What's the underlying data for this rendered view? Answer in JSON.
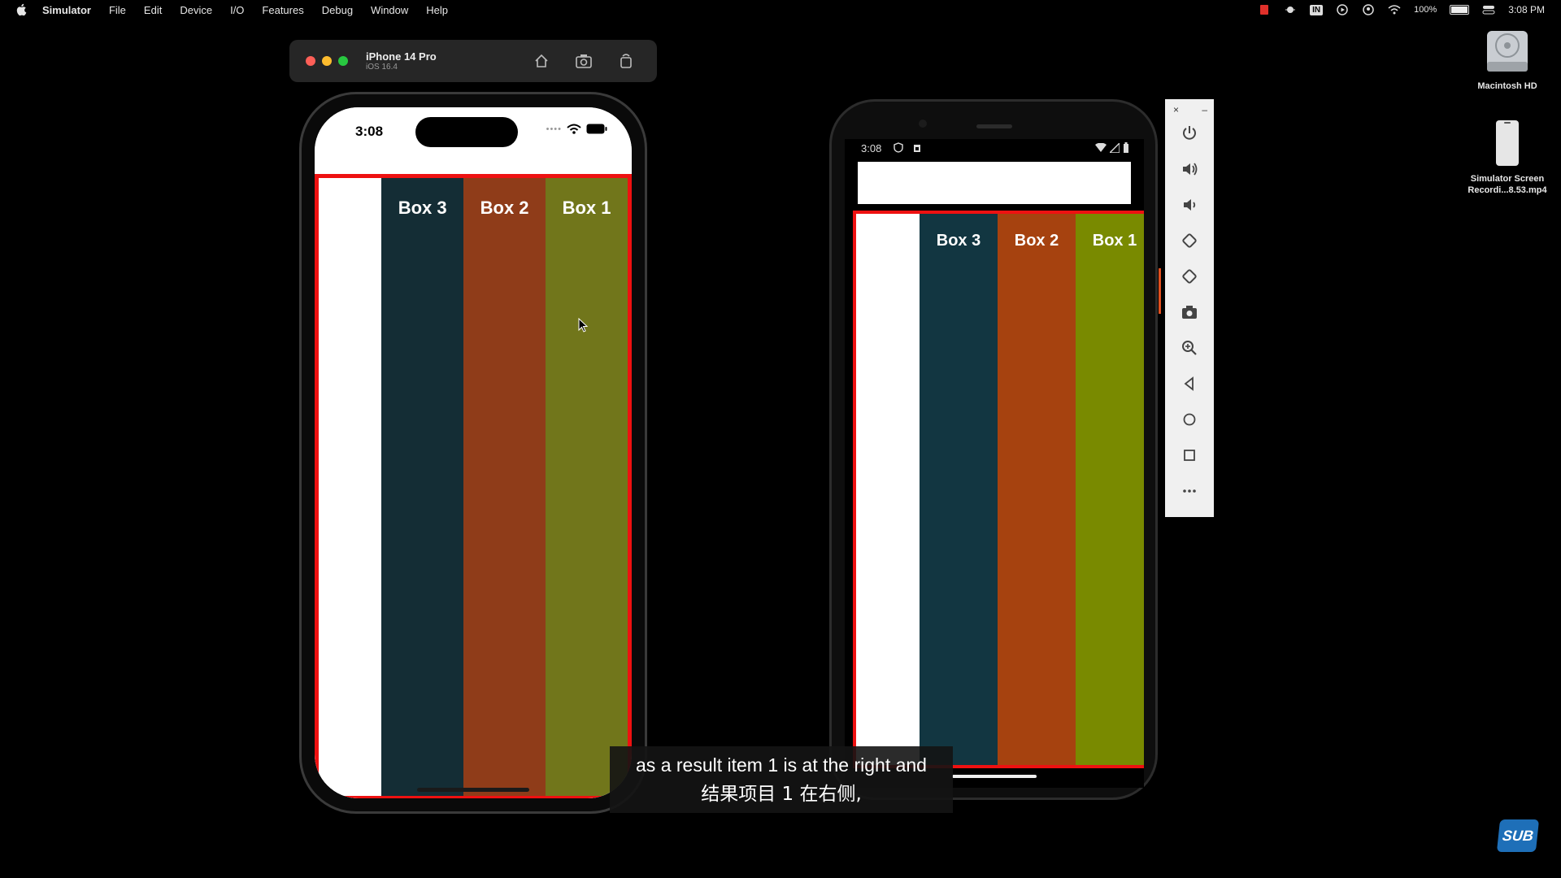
{
  "menubar": {
    "app_name": "Simulator",
    "items": [
      "File",
      "Edit",
      "Device",
      "I/O",
      "Features",
      "Debug",
      "Window",
      "Help"
    ],
    "battery": "100%",
    "clock": "3:08 PM",
    "status_icons": [
      "record-icon",
      "bug-icon",
      "input-indicator-icon",
      "play-icon",
      "user-icon",
      "wifi-icon",
      "battery-icon",
      "control-center-icon"
    ],
    "input_source": "IN"
  },
  "desktop": {
    "icons": [
      {
        "label": "Macintosh HD",
        "icon": "hard-drive-icon"
      },
      {
        "label": "Simulator Screen\nRecordi...8.53.mp4",
        "icon": "video-file-icon"
      }
    ]
  },
  "ios_simulator": {
    "device_name": "iPhone 14 Pro",
    "os_version": "iOS 16.4",
    "toolbar_buttons": [
      "home-icon",
      "screenshot-icon",
      "rotate-icon"
    ],
    "status_time": "3:08",
    "boxes": [
      {
        "label": "Box 3",
        "color": "#142d35"
      },
      {
        "label": "Box 2",
        "color": "#8f3c19"
      },
      {
        "label": "Box 1",
        "color": "#71761b"
      }
    ],
    "border_color": "#ee1111"
  },
  "android_emulator": {
    "status_time": "3:08",
    "boxes": [
      {
        "label": "Box 3",
        "color": "#123641"
      },
      {
        "label": "Box 2",
        "color": "#a6420f"
      },
      {
        "label": "Box 1",
        "color": "#798a00"
      }
    ],
    "border_color": "#ee1111",
    "side_toolbar": {
      "close": "×",
      "minimize": "–",
      "buttons": [
        "power-icon",
        "volume-up-icon",
        "volume-down-icon",
        "rotate-left-icon",
        "rotate-right-icon",
        "camera-icon",
        "zoom-icon",
        "back-icon",
        "home-circle-icon",
        "overview-square-icon",
        "more-icon"
      ]
    }
  },
  "subtitle": {
    "line1": "as a result item 1 is at the right and",
    "line2": "结果项目 1 在右侧,"
  },
  "badge": "SUB"
}
